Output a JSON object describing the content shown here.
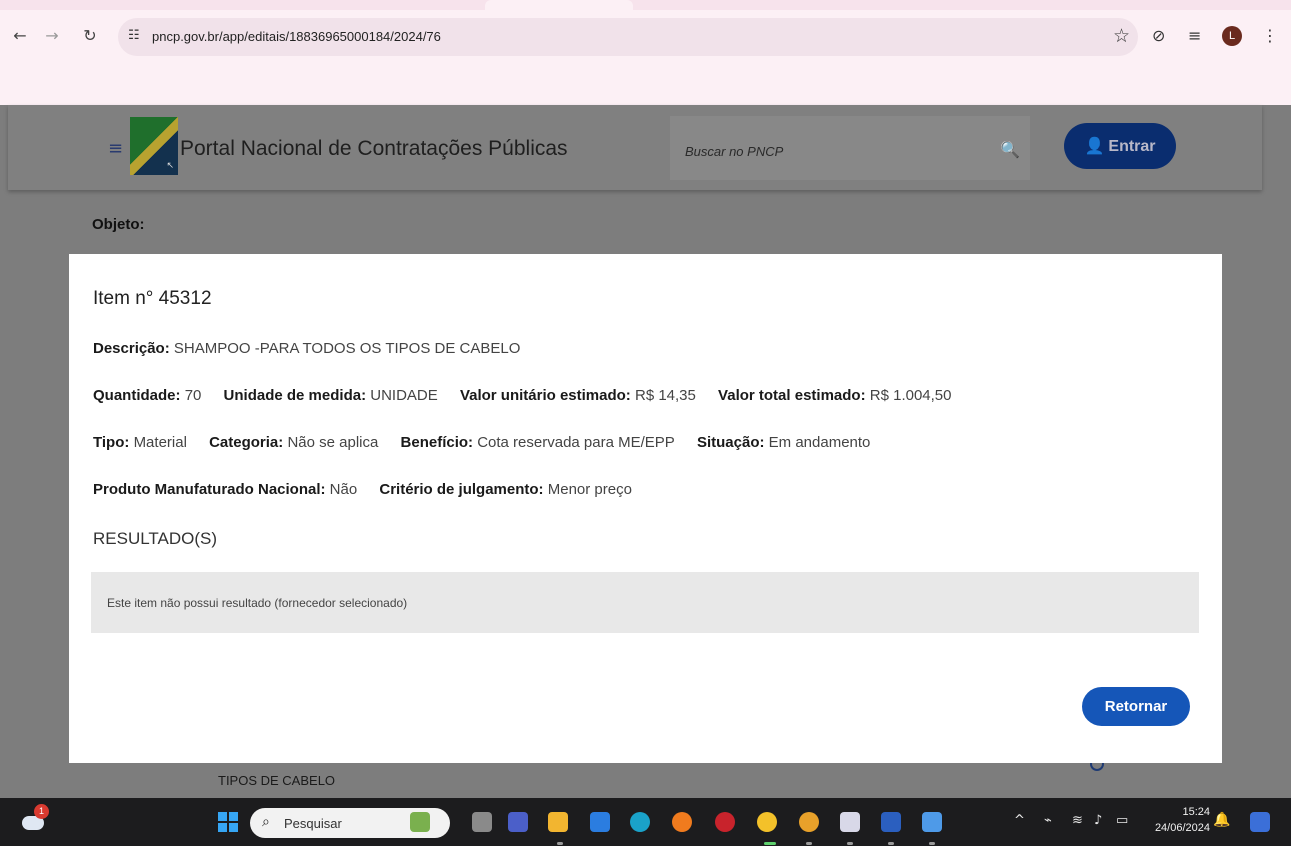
{
  "browser": {
    "url": "pncp.gov.br/app/editais/18836965000184/2024/76",
    "profile_initial": "L"
  },
  "site": {
    "title": "Portal Nacional de Contratações Públicas",
    "search_placeholder": "Buscar no PNCP",
    "login_label": "Entrar",
    "objeto_label": "Objeto:",
    "background_text": "TIPOS DE CABELO"
  },
  "modal": {
    "title": "Item n° 45312",
    "descricao_label": "Descrição:",
    "descricao_value": "SHAMPOO -PARA TODOS OS TIPOS DE CABELO",
    "quantidade_label": "Quantidade:",
    "quantidade_value": "70",
    "unidade_label": "Unidade de medida:",
    "unidade_value": "UNIDADE",
    "valor_unitario_label": "Valor unitário estimado:",
    "valor_unitario_value": "R$ 14,35",
    "valor_total_label": "Valor total estimado:",
    "valor_total_value": "R$ 1.004,50",
    "tipo_label": "Tipo:",
    "tipo_value": "Material",
    "categoria_label": "Categoria:",
    "categoria_value": "Não se aplica",
    "beneficio_label": "Benefício:",
    "beneficio_value": "Cota reservada para ME/EPP",
    "situacao_label": "Situação:",
    "situacao_value": "Em andamento",
    "produto_label": "Produto Manufaturado Nacional:",
    "produto_value": "Não",
    "criterio_label": "Critério de julgamento:",
    "criterio_value": "Menor preço",
    "resultados_heading": "RESULTADO(S)",
    "resultado_message": "Este item não possui resultado (fornecedor selecionado)",
    "return_label": "Retornar"
  },
  "taskbar": {
    "search_label": "Pesquisar",
    "weather_badge": "1",
    "time": "15:24",
    "date": "24/06/2024"
  },
  "colors": {
    "primary": "#1556b8",
    "header_button": "#0a2d6f",
    "overlay": "#7d7d7d"
  }
}
